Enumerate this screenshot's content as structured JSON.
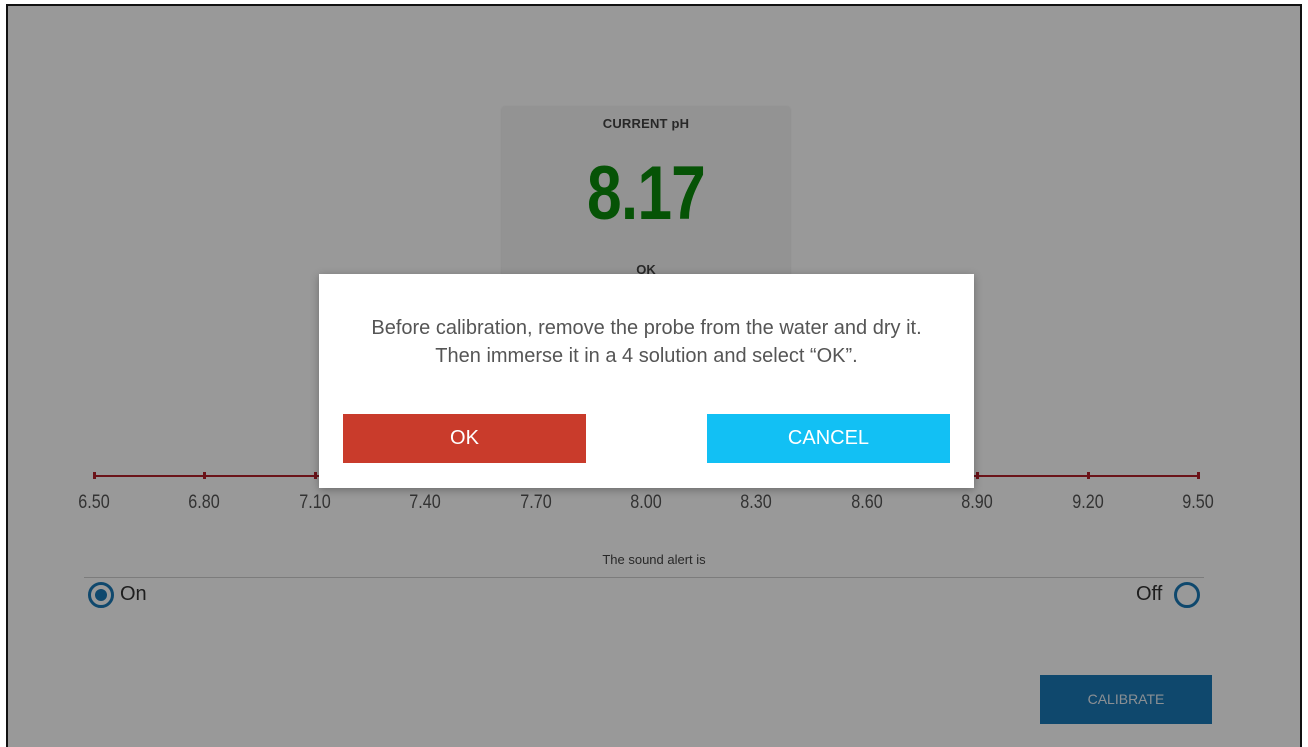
{
  "ph_card": {
    "title": "CURRENT pH",
    "value": "8.17",
    "status": "OK"
  },
  "scale": {
    "ticks": [
      "6.50",
      "6.80",
      "7.10",
      "7.40",
      "7.70",
      "8.00",
      "8.30",
      "8.60",
      "8.90",
      "9.20",
      "9.50"
    ]
  },
  "sound": {
    "label": "The sound alert is",
    "on_label": "On",
    "off_label": "Off",
    "selected": "On"
  },
  "calibrate_button": "CALIBRATE",
  "modal": {
    "line1": "Before calibration, remove the probe from the water and dry it.",
    "line2": "Then immerse it in a 4 solution and select “OK”.",
    "ok_label": "OK",
    "cancel_label": "CANCEL"
  },
  "colors": {
    "ph_value": "#0b8a0b",
    "scale_line": "#b3202a",
    "accent_blue": "#1a79b6",
    "ok_button": "#c93b2b",
    "cancel_button": "#12c0f4"
  }
}
